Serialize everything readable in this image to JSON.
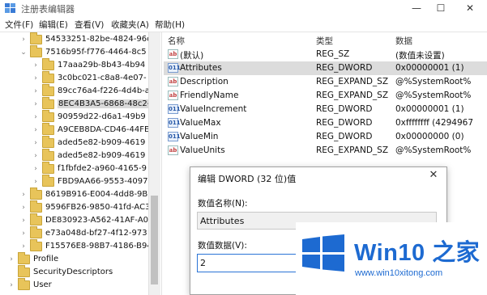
{
  "window": {
    "title": "注册表编辑器",
    "minimize": "—",
    "maximize": "☐",
    "close": "✕"
  },
  "menu": [
    "文件(F)",
    "编辑(E)",
    "查看(V)",
    "收藏夹(A)",
    "帮助(H)"
  ],
  "tree": {
    "items": [
      {
        "label": "54533251-82be-4824-96c",
        "arrow": "›",
        "level": 2
      },
      {
        "label": "7516b95f-f776-4464-8c5",
        "arrow": "⌄",
        "level": 2
      },
      {
        "label": "17aaa29b-8b43-4b94",
        "arrow": "›",
        "level": 3
      },
      {
        "label": "3c0bc021-c8a8-4e07-",
        "arrow": "›",
        "level": 3
      },
      {
        "label": "89cc76a4-f226-4d4b-a",
        "arrow": "›",
        "level": 3
      },
      {
        "label": "8EC4B3A5-6868-48c2-",
        "arrow": "›",
        "level": 3,
        "selected": true
      },
      {
        "label": "90959d22-d6a1-49b9",
        "arrow": "›",
        "level": 3
      },
      {
        "label": "A9CEB8DA-CD46-44FE",
        "arrow": "›",
        "level": 3
      },
      {
        "label": "aded5e82-b909-4619",
        "arrow": "›",
        "level": 3
      },
      {
        "label": "aded5e82-b909-4619",
        "arrow": "›",
        "level": 3
      },
      {
        "label": "f1fbfde2-a960-4165-9",
        "arrow": "›",
        "level": 3
      },
      {
        "label": "FBD9AA66-9553-4097",
        "arrow": "›",
        "level": 3
      },
      {
        "label": "8619B916-E004-4dd8-9B",
        "arrow": "›",
        "level": 2
      },
      {
        "label": "9596FB26-9850-41fd-AC3",
        "arrow": "›",
        "level": 2
      },
      {
        "label": "DE830923-A562-41AF-A0",
        "arrow": "›",
        "level": 2
      },
      {
        "label": "e73a048d-bf27-4f12-973",
        "arrow": "›",
        "level": 2
      },
      {
        "label": "F15576E8-98B7-4186-B94",
        "arrow": "›",
        "level": 2
      },
      {
        "label": "Profile",
        "arrow": "›",
        "level": 1
      },
      {
        "label": "SecurityDescriptors",
        "arrow": "",
        "level": 1
      },
      {
        "label": "User",
        "arrow": "›",
        "level": 1
      }
    ]
  },
  "list": {
    "columns": [
      "名称",
      "类型",
      "数据"
    ],
    "rows": [
      {
        "icon": "ab",
        "name": "(默认)",
        "type": "REG_SZ",
        "data": "(数值未设置)"
      },
      {
        "icon": "bin",
        "name": "Attributes",
        "type": "REG_DWORD",
        "data": "0x00000001 (1)",
        "selected": true
      },
      {
        "icon": "ab",
        "name": "Description",
        "type": "REG_EXPAND_SZ",
        "data": "@%SystemRoot%"
      },
      {
        "icon": "ab",
        "name": "FriendlyName",
        "type": "REG_EXPAND_SZ",
        "data": "@%SystemRoot%"
      },
      {
        "icon": "bin",
        "name": "ValueIncrement",
        "type": "REG_DWORD",
        "data": "0x00000001 (1)"
      },
      {
        "icon": "bin",
        "name": "ValueMax",
        "type": "REG_DWORD",
        "data": "0xffffffff (4294967"
      },
      {
        "icon": "bin",
        "name": "ValueMin",
        "type": "REG_DWORD",
        "data": "0x00000000 (0)"
      },
      {
        "icon": "ab",
        "name": "ValueUnits",
        "type": "REG_EXPAND_SZ",
        "data": "@%SystemRoot%"
      }
    ]
  },
  "dialog": {
    "title": "编辑 DWORD (32 位)值",
    "close": "✕",
    "name_label": "数值名称(N):",
    "name_value": "Attributes",
    "data_label": "数值数据(V):",
    "data_value": "2"
  },
  "brand": {
    "name": "Win10 之家",
    "url": "www.win10xitong.com",
    "color": "#1d6ad1"
  },
  "icons": {
    "string_value": "ab",
    "binary_value": "011"
  }
}
